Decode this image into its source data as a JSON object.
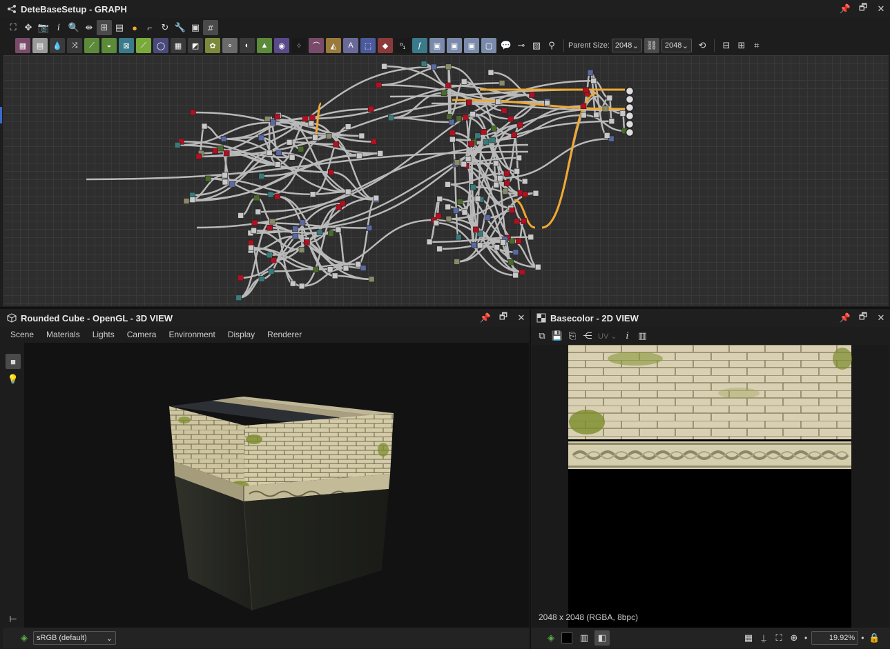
{
  "graph_panel": {
    "title": "DeteBaseSetup - GRAPH",
    "toolbar2": {
      "parent_size_label": "Parent Size:",
      "width_value": "2048",
      "height_value": "2048"
    }
  },
  "view3d_panel": {
    "title": "Rounded Cube - OpenGL - 3D VIEW",
    "menu": [
      "Scene",
      "Materials",
      "Lights",
      "Camera",
      "Environment",
      "Display",
      "Renderer"
    ],
    "colorspace": "sRGB (default)"
  },
  "view2d_panel": {
    "title": "Basecolor - 2D VIEW",
    "uv_label": "UV",
    "image_info": "2048 x 2048 (RGBA, 8bpc)",
    "zoom": "19.92%"
  },
  "icons": [
    "graph-icon",
    "pin-icon",
    "maximize-icon",
    "close-icon",
    "cube-icon",
    "checker-icon",
    "camera-icon",
    "lightbulb-icon",
    "lock-icon"
  ],
  "colors": {
    "background": "#1d1d1d",
    "graph_bg": "#2e2e2e",
    "output_link": "#f0a830",
    "link": "#b9b9b9",
    "param_node": "#b01020"
  }
}
